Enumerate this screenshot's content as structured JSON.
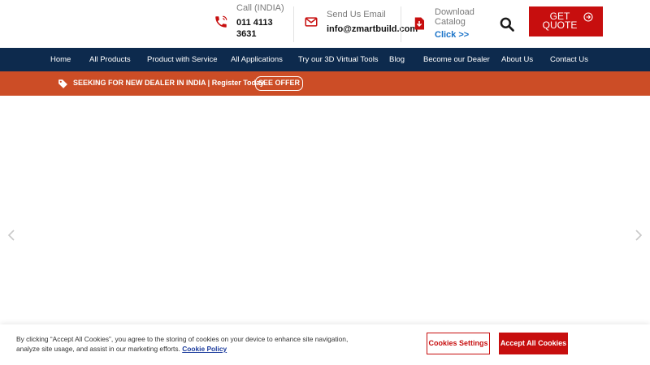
{
  "header": {
    "call": {
      "label": "Call (INDIA)",
      "number": "011 4113 3631"
    },
    "email": {
      "label": "Send Us Email",
      "address": "info@zmartbuild.com"
    },
    "catalog": {
      "label": "Download Catalog",
      "link": "Click >>"
    },
    "quote_button": "GET QUOTE"
  },
  "nav": {
    "items": [
      {
        "label": "Home"
      },
      {
        "label": "All Products"
      },
      {
        "label": "Product with Service"
      },
      {
        "label": "All Applications"
      },
      {
        "label": "Try our 3D Virtual Tools"
      },
      {
        "label": "Blog"
      },
      {
        "label": "Become our Dealer"
      },
      {
        "label": "About Us"
      },
      {
        "label": "Contact Us"
      }
    ]
  },
  "promo": {
    "text": "SEEKING FOR NEW DEALER IN INDIA | Register Today",
    "button": "SEE OFFER"
  },
  "cookie": {
    "text": "By clicking “Accept All Cookies”, you agree to the storing of cookies on your device to enhance site navigation, analyze site usage, and assist in our marketing efforts.",
    "policy_link": "Cookie Policy",
    "settings_button": "Cookies Settings",
    "accept_button": "Accept All Cookies"
  },
  "colors": {
    "brand_red": "#c70e0e",
    "nav_bg": "#0d2a4d",
    "promo_bg": "#cc4d26",
    "link_blue": "#1a73c8"
  },
  "icons": {
    "call": "phone-icon",
    "email": "envelope-icon",
    "catalog": "download-pdf-icon",
    "search": "search-icon",
    "quote": "arrow-circle-icon",
    "promo": "tag-icon",
    "slider_prev": "chevron-left-icon",
    "slider_next": "chevron-right-icon"
  }
}
